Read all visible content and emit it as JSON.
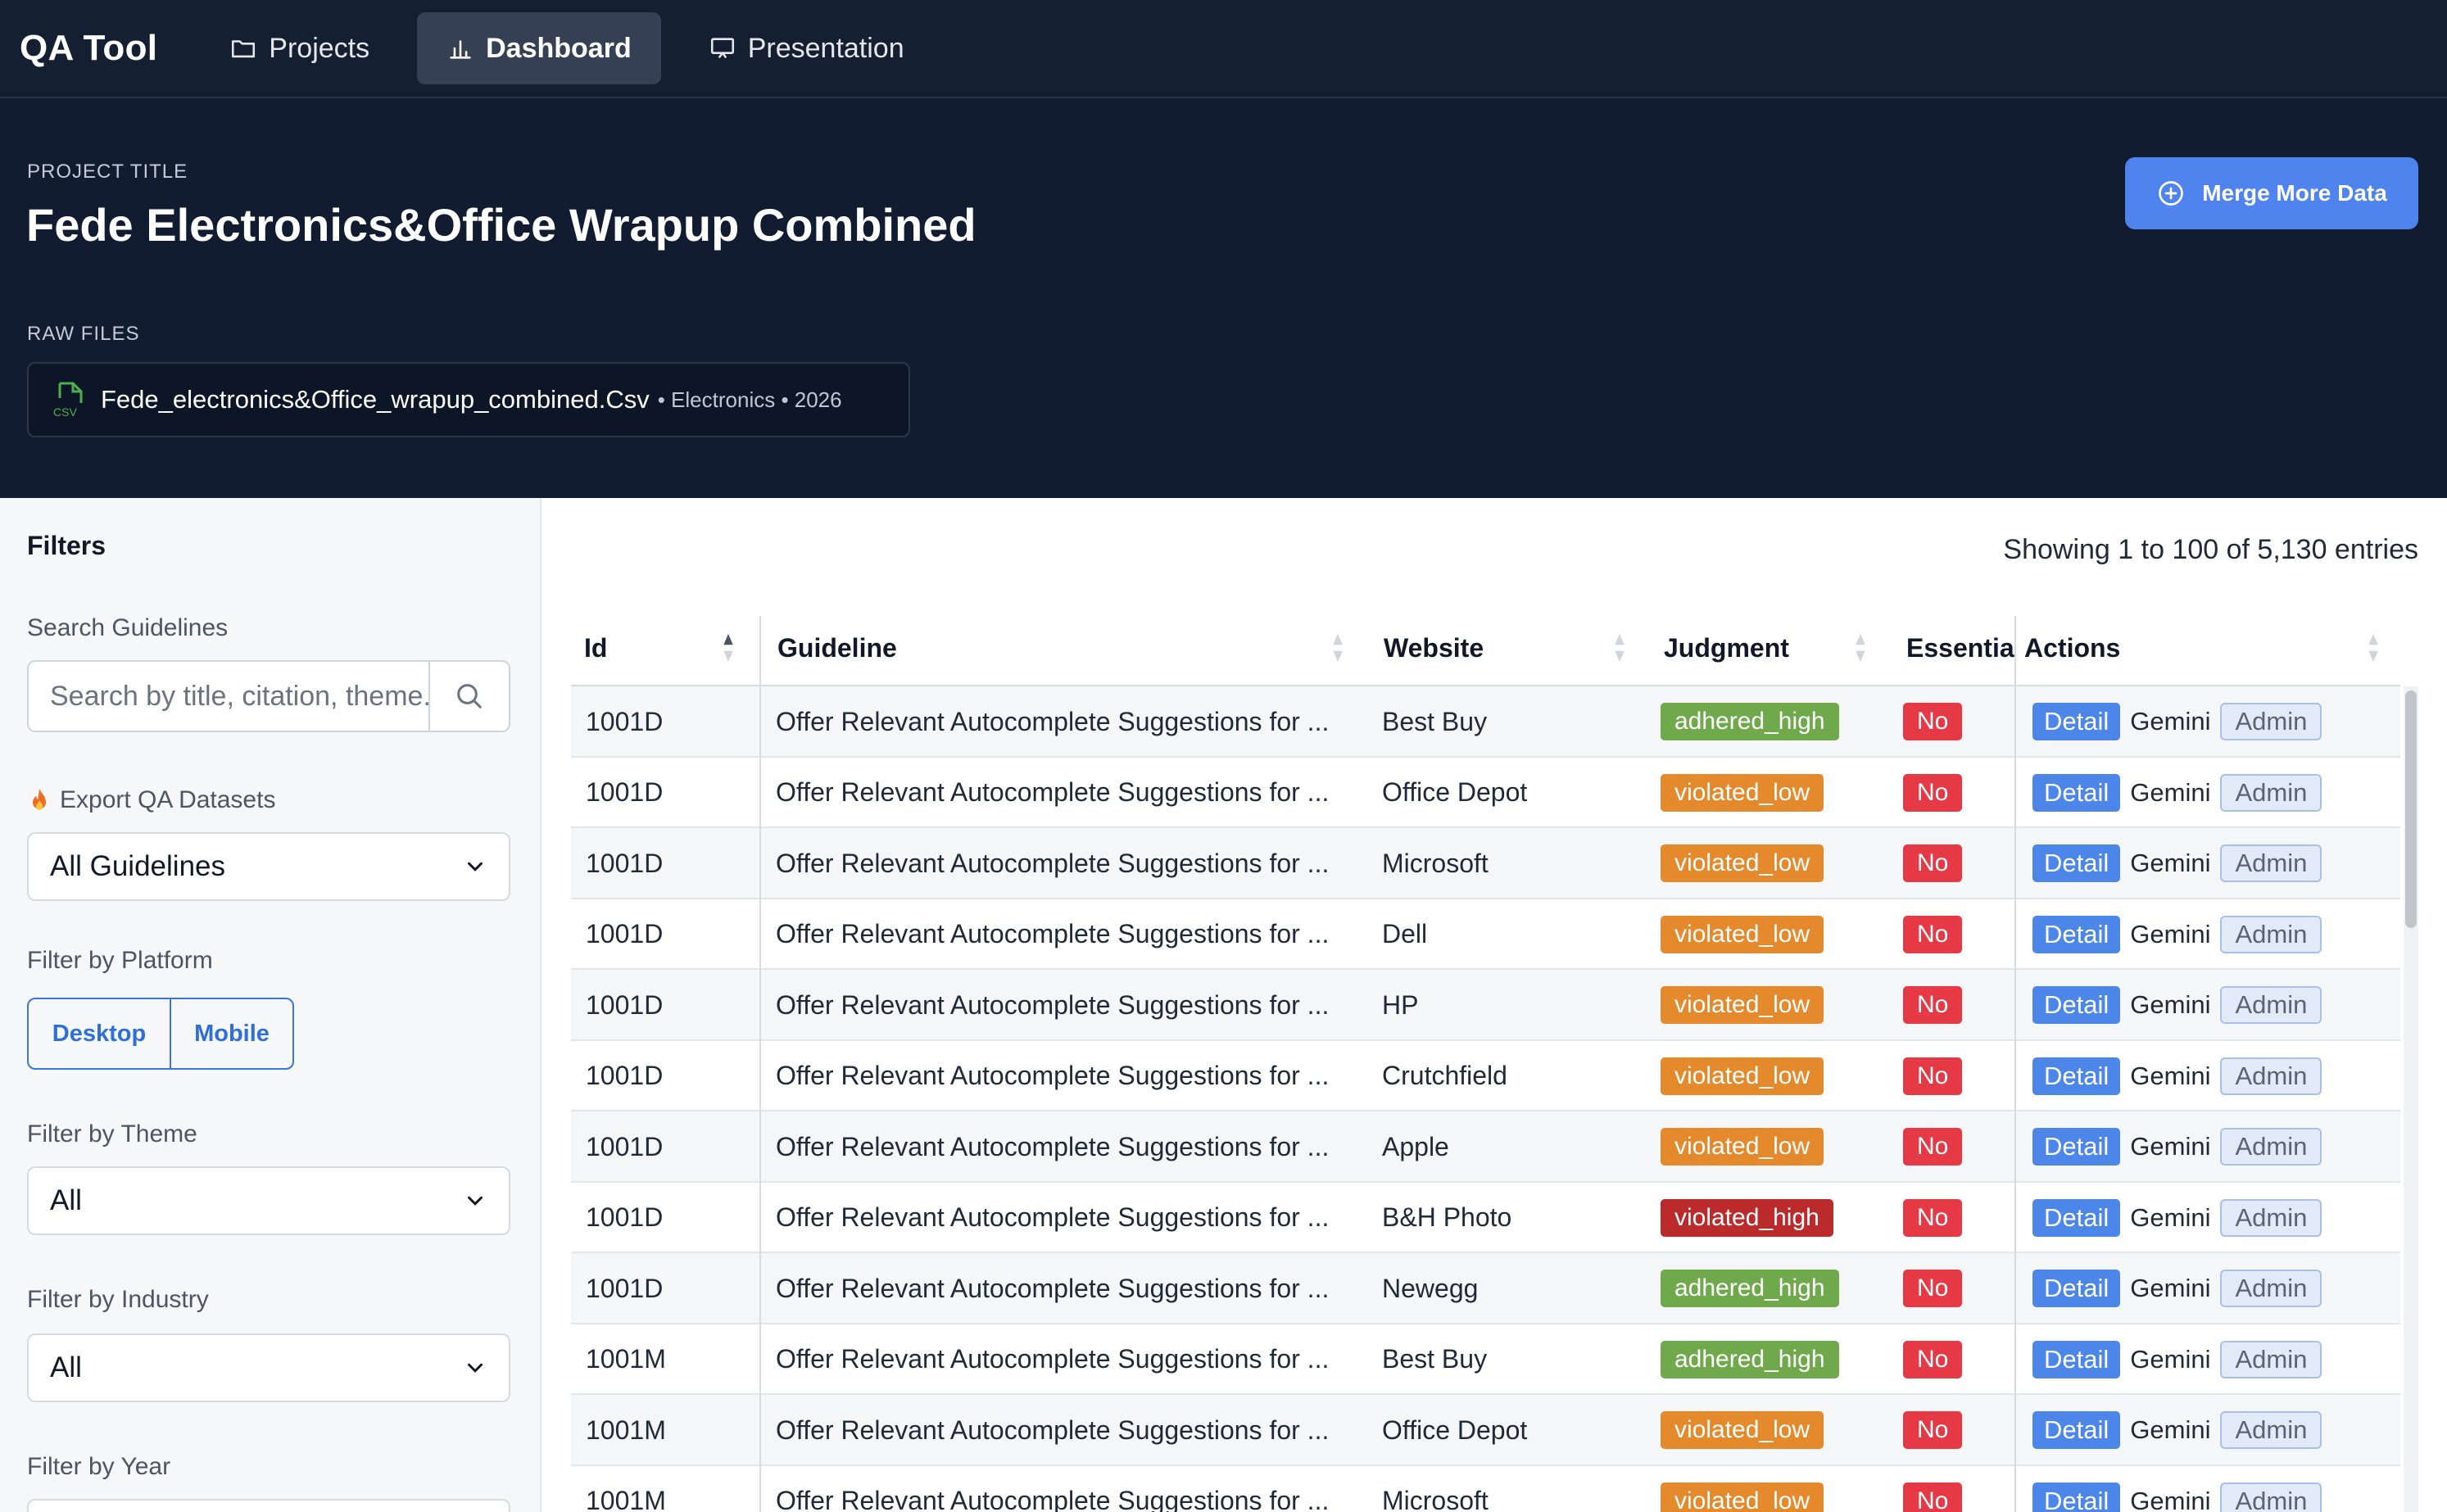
{
  "nav": {
    "brand": "QA Tool",
    "items": [
      {
        "label": "Projects",
        "icon": "folder-icon",
        "active": false
      },
      {
        "label": "Dashboard",
        "icon": "bar-chart-icon",
        "active": true
      },
      {
        "label": "Presentation",
        "icon": "presentation-icon",
        "active": false
      }
    ]
  },
  "project": {
    "title_caption": "PROJECT TITLE",
    "title": "Fede Electronics&Office Wrapup Combined",
    "merge_button": "Merge More Data",
    "raw_files_caption": "RAW FILES",
    "file": {
      "icon": "csv-file-icon",
      "icon_text": "CSV",
      "name": "Fede_electronics&Office_wrapup_combined.Csv",
      "meta": "• Electronics • 2026"
    }
  },
  "sidebar": {
    "title": "Filters",
    "search_label": "Search Guidelines",
    "search_placeholder": "Search by title, citation, theme...",
    "export_label": "Export QA Datasets",
    "export_value": "All Guidelines",
    "platform_label": "Filter by Platform",
    "platform_options": [
      "Desktop",
      "Mobile"
    ],
    "theme_label": "Filter by Theme",
    "theme_value": "All",
    "industry_label": "Filter by Industry",
    "industry_value": "All",
    "year_label": "Filter by Year"
  },
  "table": {
    "entries_text": "Showing 1 to 100 of 5,130 entries",
    "columns": [
      "Id",
      "Guideline",
      "Website",
      "Judgment",
      "Essentia",
      "Actions"
    ],
    "action_labels": {
      "detail": "Detail",
      "gemini": "Gemini",
      "admin": "Admin"
    },
    "rows": [
      {
        "id": "1001D",
        "guideline": "Offer Relevant Autocomplete Suggestions for ...",
        "website": "Best Buy",
        "judgment": "adhered_high",
        "essential": "No"
      },
      {
        "id": "1001D",
        "guideline": "Offer Relevant Autocomplete Suggestions for ...",
        "website": "Office Depot",
        "judgment": "violated_low",
        "essential": "No"
      },
      {
        "id": "1001D",
        "guideline": "Offer Relevant Autocomplete Suggestions for ...",
        "website": "Microsoft",
        "judgment": "violated_low",
        "essential": "No"
      },
      {
        "id": "1001D",
        "guideline": "Offer Relevant Autocomplete Suggestions for ...",
        "website": "Dell",
        "judgment": "violated_low",
        "essential": "No"
      },
      {
        "id": "1001D",
        "guideline": "Offer Relevant Autocomplete Suggestions for ...",
        "website": "HP",
        "judgment": "violated_low",
        "essential": "No"
      },
      {
        "id": "1001D",
        "guideline": "Offer Relevant Autocomplete Suggestions for ...",
        "website": "Crutchfield",
        "judgment": "violated_low",
        "essential": "No"
      },
      {
        "id": "1001D",
        "guideline": "Offer Relevant Autocomplete Suggestions for ...",
        "website": "Apple",
        "judgment": "violated_low",
        "essential": "No"
      },
      {
        "id": "1001D",
        "guideline": "Offer Relevant Autocomplete Suggestions for ...",
        "website": "B&H Photo",
        "judgment": "violated_high",
        "essential": "No"
      },
      {
        "id": "1001D",
        "guideline": "Offer Relevant Autocomplete Suggestions for ...",
        "website": "Newegg",
        "judgment": "adhered_high",
        "essential": "No"
      },
      {
        "id": "1001M",
        "guideline": "Offer Relevant Autocomplete Suggestions for ...",
        "website": "Best Buy",
        "judgment": "adhered_high",
        "essential": "No"
      },
      {
        "id": "1001M",
        "guideline": "Offer Relevant Autocomplete Suggestions for ...",
        "website": "Office Depot",
        "judgment": "violated_low",
        "essential": "No"
      },
      {
        "id": "1001M",
        "guideline": "Offer Relevant Autocomplete Suggestions for ...",
        "website": "Microsoft",
        "judgment": "violated_low",
        "essential": "No"
      }
    ]
  },
  "colors": {
    "nav_bg": "#151f32",
    "header_bg": "#111c31",
    "accent": "#4f84ee",
    "adhered_high": "#70a94b",
    "violated_low": "#e58a2c",
    "violated_high": "#bb2b2b",
    "essential_no": "#e63946"
  }
}
